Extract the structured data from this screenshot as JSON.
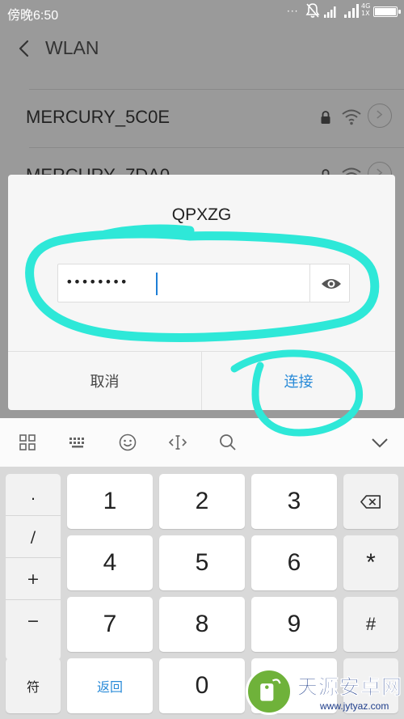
{
  "status_bar": {
    "time": "傍晚6:50",
    "dots": "···",
    "network_type_top": "4G",
    "network_type_bottom": "1X",
    "battery_level": 1.0
  },
  "header": {
    "title": "WLAN"
  },
  "wifi_list": [
    {
      "name": "MERCURY_5C0E"
    },
    {
      "name": "MERCURY_7DA0"
    }
  ],
  "dialog": {
    "title": "QPXZG",
    "password_masked": "••••••••",
    "cancel_label": "取消",
    "connect_label": "连接"
  },
  "keyboard": {
    "symbols": [
      ".",
      "/",
      "+",
      "−"
    ],
    "digits": [
      "1",
      "2",
      "3",
      "4",
      "5",
      "6",
      "7",
      "8",
      "9",
      "0"
    ],
    "asterisk": "*",
    "hash": "#",
    "fu_label": "符",
    "back_label": "返回"
  },
  "watermark": {
    "title": "天源安卓网",
    "url": "www.jytyaz.com"
  },
  "colors": {
    "accent": "#2a8bd8",
    "annotation": "#2ee8d8",
    "overlay": "#9a9a9a"
  }
}
